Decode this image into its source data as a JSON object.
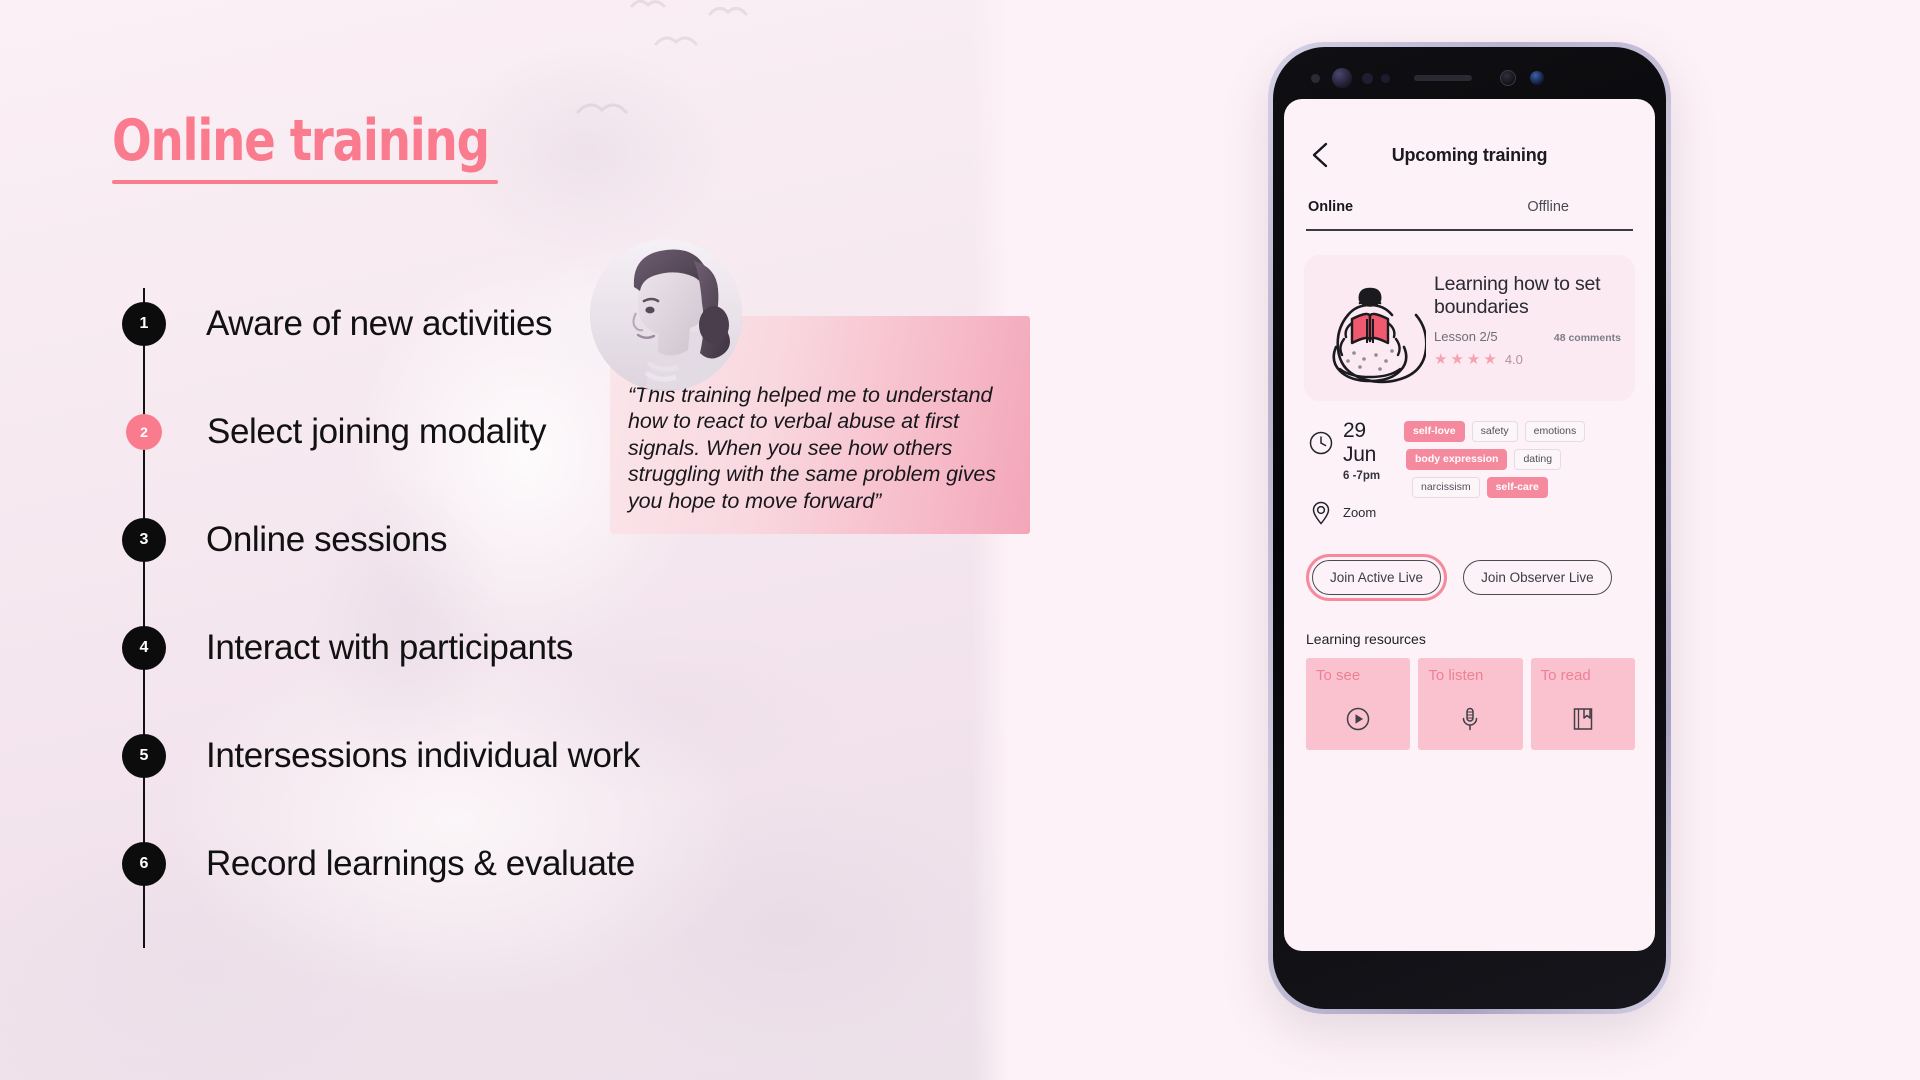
{
  "slide": {
    "heading": "Online training"
  },
  "timeline": {
    "steps": [
      {
        "num": "1",
        "label": "Aware of new activities",
        "accent": false
      },
      {
        "num": "2",
        "label": "Select joining modality",
        "accent": true
      },
      {
        "num": "3",
        "label": "Online sessions",
        "accent": false
      },
      {
        "num": "4",
        "label": "Interact with participants",
        "accent": false
      },
      {
        "num": "5",
        "label": "Intersessions individual work",
        "accent": false
      },
      {
        "num": "6",
        "label": "Record learnings & evaluate",
        "accent": false
      }
    ]
  },
  "testimonial": {
    "quote": "“This training helped me to understand how to react to verbal abuse at first signals. When you see how others struggling with the same problem gives you hope to move forward”",
    "avatar_alt": "woman-profile-portrait"
  },
  "phone": {
    "header": {
      "back_icon": "chevron-left-icon",
      "title": "Upcoming training"
    },
    "tabs": [
      {
        "label": "Online",
        "active": true
      },
      {
        "label": "Offline",
        "active": false
      }
    ],
    "card": {
      "illustration": "person-reading-book-illustration",
      "title": "Learning how to set boundaries",
      "lesson": "Lesson 2/5",
      "comments": "48 comments",
      "stars": 4,
      "rating": "4.0",
      "star_glyph": "★"
    },
    "details": {
      "clock_icon": "clock-icon",
      "date": "29 Jun",
      "time": "6 -7pm",
      "location_icon": "location-pin-icon",
      "location": "Zoom"
    },
    "tags": [
      [
        {
          "label": "self-love",
          "filled": true
        },
        {
          "label": "safety",
          "filled": false
        },
        {
          "label": "emotions",
          "filled": false
        }
      ],
      [
        {
          "label": "body expression",
          "filled": true
        },
        {
          "label": "dating",
          "filled": false
        }
      ],
      [
        {
          "label": "narcissism",
          "filled": false
        },
        {
          "label": "self-care",
          "filled": true
        }
      ]
    ],
    "buttons": {
      "primary": "Join Active Live",
      "secondary": "Join Observer Live"
    },
    "resources": {
      "title": "Learning resources",
      "items": [
        {
          "label": "To see",
          "icon": "play-circle-icon"
        },
        {
          "label": "To listen",
          "icon": "microphone-icon"
        },
        {
          "label": "To read",
          "icon": "book-bookmark-icon"
        }
      ]
    }
  },
  "colors": {
    "accent_pink": "#fb7b8e",
    "tag_pink": "#f58a9e",
    "resource_pink": "#f9c2ce",
    "background": "#fdf2f7",
    "left_panel": "#f8eaf1"
  }
}
